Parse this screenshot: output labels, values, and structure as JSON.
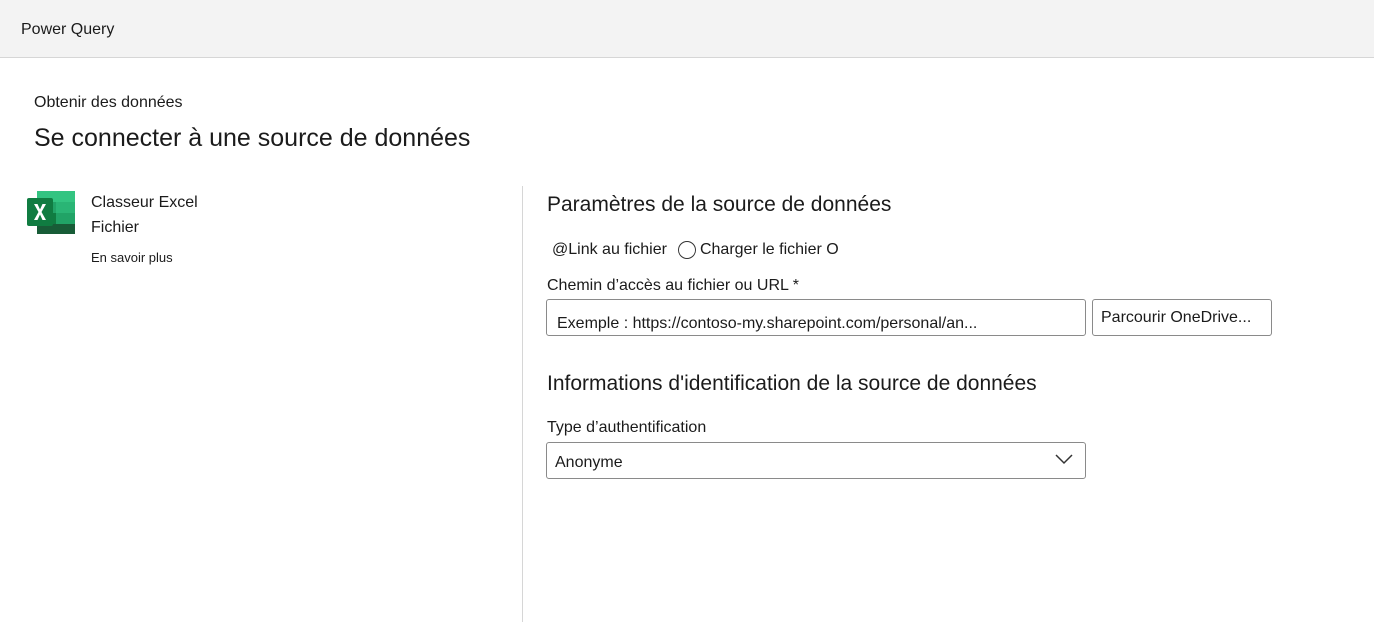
{
  "header": {
    "app_title": "Power Query"
  },
  "page": {
    "breadcrumb": "Obtenir des données",
    "title": "Se connecter à une source de données"
  },
  "connector": {
    "icon": "excel-icon",
    "icon_colors": {
      "dark": "#185c37",
      "mid": "#21a366",
      "light": "#33c481",
      "accent": "#107c41"
    },
    "name": "Classeur Excel",
    "category": "Fichier",
    "learn_more": "En savoir plus"
  },
  "settings": {
    "title": "Paramètres de la source de données",
    "radio_options": [
      {
        "label": "@Link au fichier",
        "selected": false
      },
      {
        "label": "Charger le fichier O",
        "selected": false
      }
    ],
    "path_label": "Chemin d’accès au fichier ou URL *",
    "path_placeholder": "Exemple : https://contoso-my.sharepoint.com/personal/an...",
    "path_value": "",
    "browse_label": "Parcourir OneDrive..."
  },
  "credentials": {
    "title": "Informations d'identification de la source de données",
    "auth_label": "Type d’authentification",
    "auth_selected": "Anonyme"
  }
}
